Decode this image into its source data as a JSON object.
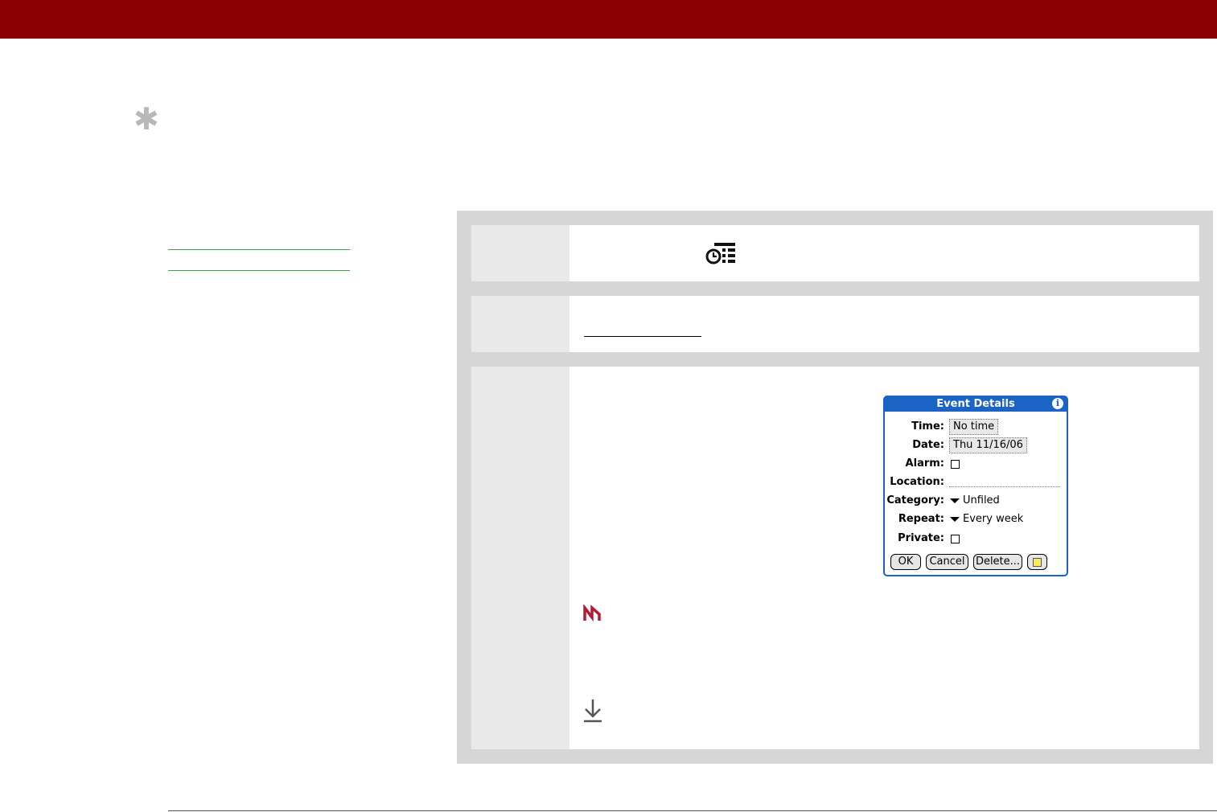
{
  "colors": {
    "header_bar": "#8b0000",
    "tip_icon": "#b8b8b8",
    "link_rule": "#3aa83a",
    "procedure_frame": "#d6d6d6",
    "dialog_accent": "#1b63c4",
    "warning_icon": "#b31b34"
  },
  "icons": {
    "tip": "asterisk-icon",
    "calendar_view": "agenda-view-icon",
    "important": "important-icon",
    "continued": "continued-arrow-icon",
    "dialog_info": "info-icon",
    "dialog_note": "note-icon"
  },
  "dialog": {
    "title": "Event Details",
    "info_glyph": "i",
    "fields": {
      "time_label": "Time:",
      "time_value": "No time",
      "date_label": "Date:",
      "date_value": "Thu 11/16/06",
      "alarm_label": "Alarm:",
      "location_label": "Location:",
      "category_label": "Category:",
      "category_value": "Unfiled",
      "repeat_label": "Repeat:",
      "repeat_value": "Every week",
      "private_label": "Private:"
    },
    "alarm_checked": false,
    "private_checked": false,
    "buttons": {
      "ok": "OK",
      "cancel": "Cancel",
      "delete": "Delete..."
    }
  }
}
